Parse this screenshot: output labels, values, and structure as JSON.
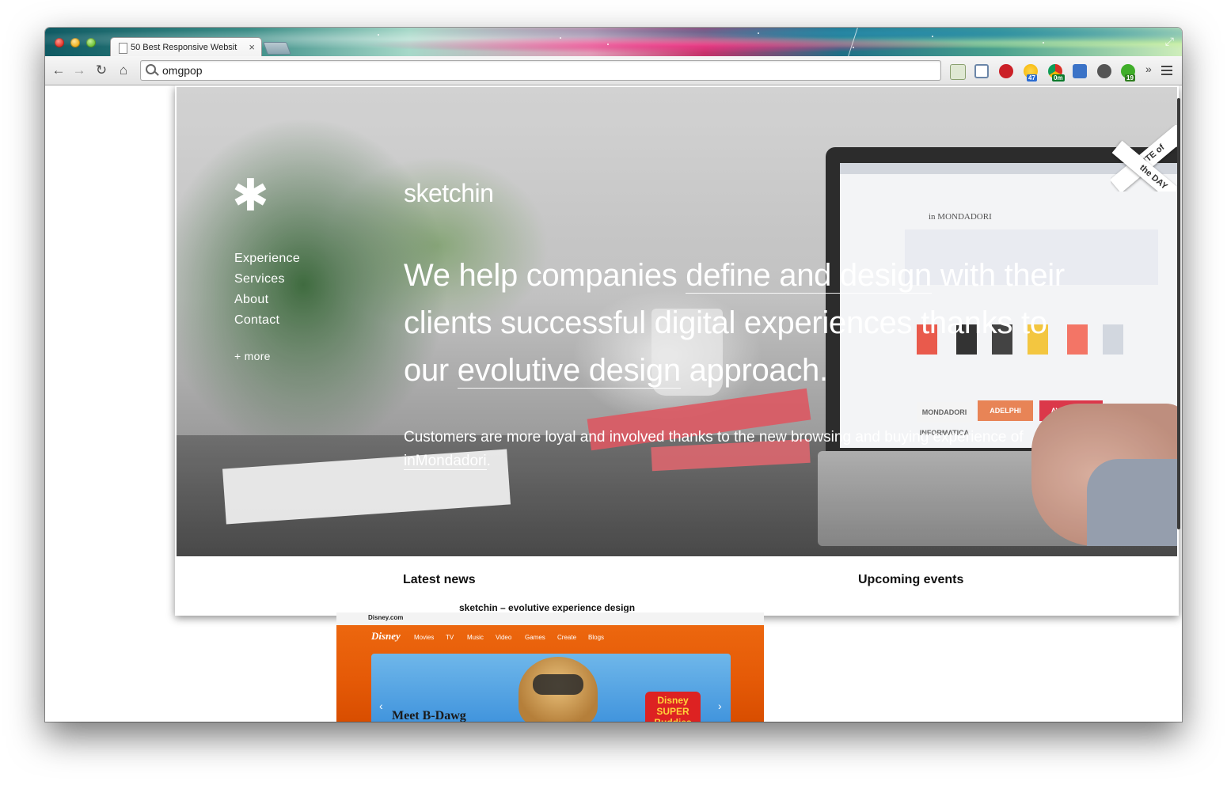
{
  "browser": {
    "tab_title": "50 Best Responsive Websit",
    "tab_close": "×",
    "address_value": "omgpop",
    "nav": {
      "back": "←",
      "forward": "→",
      "reload": "↻",
      "home": "⌂"
    },
    "extensions": [
      {
        "name": "forward-icon",
        "color": "#e0e8d8"
      },
      {
        "name": "window-icon",
        "color": "#6b86a8"
      },
      {
        "name": "pinterest-icon",
        "color": "#cb2027"
      },
      {
        "name": "weather-icon",
        "color": "#f5b400",
        "badge": "47"
      },
      {
        "name": "gmail-checker-icon",
        "color": "#d93025",
        "badge": "0m"
      },
      {
        "name": "download-icon",
        "color": "#3b73c7"
      },
      {
        "name": "clock-icon",
        "color": "#555555"
      },
      {
        "name": "evernote-icon",
        "color": "#3fae29",
        "badge": "19"
      }
    ],
    "overflow_label": "»",
    "fullscreen_icon": "⤢"
  },
  "site": {
    "logo_symbol": "✱",
    "brand": "sketchin",
    "nav": [
      "Experience",
      "Services",
      "About",
      "Contact"
    ],
    "more": "+ more",
    "headline": {
      "part1": "We help companies ",
      "link1": "define and design",
      "part2": " with their clients successful digital experiences thanks to our ",
      "link2": "evolutive design",
      "part3": " approach."
    },
    "subline": {
      "text": "Customers are more loyal and involved thanks to the new browsing and buying experience of ",
      "link": "inMondadori",
      "end": "."
    },
    "ribbon": {
      "line1": "SITE of",
      "line2": "the DAY"
    },
    "latest_news": "Latest news",
    "upcoming_events": "Upcoming events",
    "caption": "sketchin – evolutive experience design",
    "screen_logo": "in MONDADORI",
    "screen_banners": [
      "MONDADORI INFORMATICA",
      "ADELPHI",
      "AVALLARDI"
    ]
  },
  "disney": {
    "domain": "Disney.com",
    "logo": "Disney",
    "nav": [
      "Movies",
      "TV",
      "Music",
      "Video",
      "Games",
      "Create",
      "Blogs"
    ],
    "caption": "Meet B-Dawg",
    "badge": "Disney SUPER Buddies"
  },
  "colors": {
    "brand_white": "#ffffff",
    "disney_orange": "#e55a07",
    "pinterest_red": "#cb2027"
  }
}
